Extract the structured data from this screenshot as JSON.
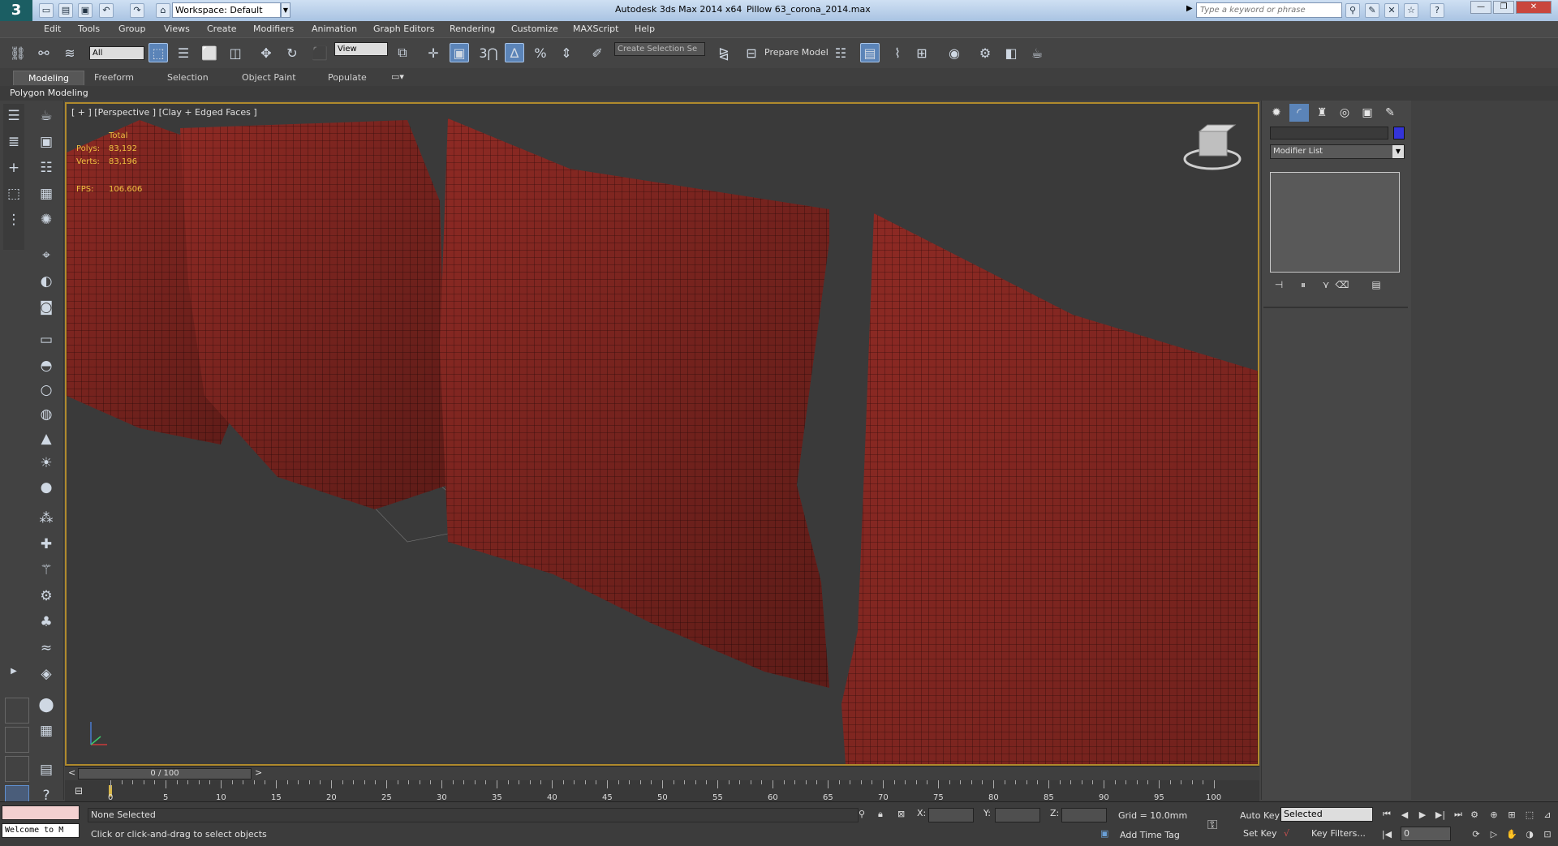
{
  "titlebar": {
    "workspace": "Workspace: Default",
    "app_title": "Autodesk 3ds Max  2014 x64",
    "document": "Pillow 63_corona_2014.max",
    "search_placeholder": "Type a keyword or phrase"
  },
  "menu": [
    "Edit",
    "Tools",
    "Group",
    "Views",
    "Create",
    "Modifiers",
    "Animation",
    "Graph Editors",
    "Rendering",
    "Customize",
    "MAXScript",
    "Help"
  ],
  "toolbar": {
    "filter_value": "All",
    "ref_coord_value": "View",
    "selection_set_placeholder": "Create Selection Se",
    "prepare_model": "Prepare Model",
    "snap_label": "3"
  },
  "ribbon": {
    "tabs": [
      "Modeling",
      "Freeform",
      "Selection",
      "Object Paint",
      "Populate"
    ],
    "active_tab": "Modeling",
    "panel": "Polygon Modeling"
  },
  "viewport": {
    "label": "[ + ] [Perspective ] [Clay + Edged Faces ]",
    "stats": {
      "total_label": "Total",
      "polys_label": "Polys:",
      "polys_value": "83,192",
      "verts_label": "Verts:",
      "verts_value": "83,196",
      "fps_label": "FPS:",
      "fps_value": "106.606"
    }
  },
  "command_panel": {
    "modifier_list": "Modifier List",
    "object_color": "#3434d8"
  },
  "timeline": {
    "slider": "0 / 100",
    "ticks": [
      "0",
      "5",
      "10",
      "15",
      "20",
      "25",
      "30",
      "35",
      "40",
      "45",
      "50",
      "55",
      "60",
      "65",
      "70",
      "75",
      "80",
      "85",
      "90",
      "95",
      "100"
    ]
  },
  "status": {
    "maxscript_listener": "Welcome to M",
    "selection": "None Selected",
    "prompt": "Click or click-and-drag to select objects",
    "x_label": "X:",
    "y_label": "Y:",
    "z_label": "Z:",
    "grid": "Grid = 10.0mm",
    "add_time_tag": "Add Time Tag",
    "auto_key": "Auto Key",
    "set_key": "Set Key",
    "key_mode": "Selected",
    "key_filters": "Key Filters...",
    "current_frame": "0"
  },
  "colors": {
    "pillow": "#8e2a24",
    "viewport_border": "#b08a2d",
    "stats_text": "#f0c040"
  }
}
